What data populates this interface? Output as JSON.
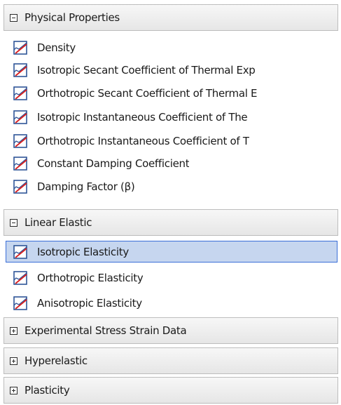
{
  "colors": {
    "chart_icon_frame": "#2f5597",
    "chart_icon_curve": "#d81e1e",
    "selection_fill": "#c6d6ef",
    "selection_border": "#3a6fd8",
    "header_border": "#bdbdbd"
  },
  "groups": [
    {
      "label": "Physical Properties",
      "expanded": true,
      "expander_icon": "collapse-minus-icon",
      "items": [
        {
          "label": "Density",
          "icon": "chart-curve-icon"
        },
        {
          "label": "Isotropic Secant Coefficient of Thermal Exp",
          "icon": "chart-curve-icon"
        },
        {
          "label": "Orthotropic Secant Coefficient of Thermal E",
          "icon": "chart-curve-icon"
        },
        {
          "label": "Isotropic Instantaneous Coefficient of The",
          "icon": "chart-curve-icon"
        },
        {
          "label": "Orthotropic Instantaneous Coefficient of T",
          "icon": "chart-curve-icon"
        },
        {
          "label": "Constant Damping Coefficient",
          "icon": "chart-curve-icon"
        },
        {
          "label": "Damping Factor (β)",
          "icon": "chart-curve-icon"
        }
      ]
    },
    {
      "label": "Linear Elastic",
      "expanded": true,
      "expander_icon": "collapse-minus-icon",
      "items": [
        {
          "label": "Isotropic Elasticity",
          "icon": "chart-curve-icon",
          "selected": true
        },
        {
          "label": "Orthotropic Elasticity",
          "icon": "chart-curve-icon"
        },
        {
          "label": "Anisotropic Elasticity",
          "icon": "chart-curve-icon"
        }
      ]
    },
    {
      "label": "Experimental Stress Strain Data",
      "expanded": false,
      "expander_icon": "expand-plus-icon",
      "items": []
    },
    {
      "label": "Hyperelastic",
      "expanded": false,
      "expander_icon": "expand-plus-icon",
      "items": []
    },
    {
      "label": "Plasticity",
      "expanded": false,
      "expander_icon": "expand-plus-icon",
      "items": []
    }
  ]
}
